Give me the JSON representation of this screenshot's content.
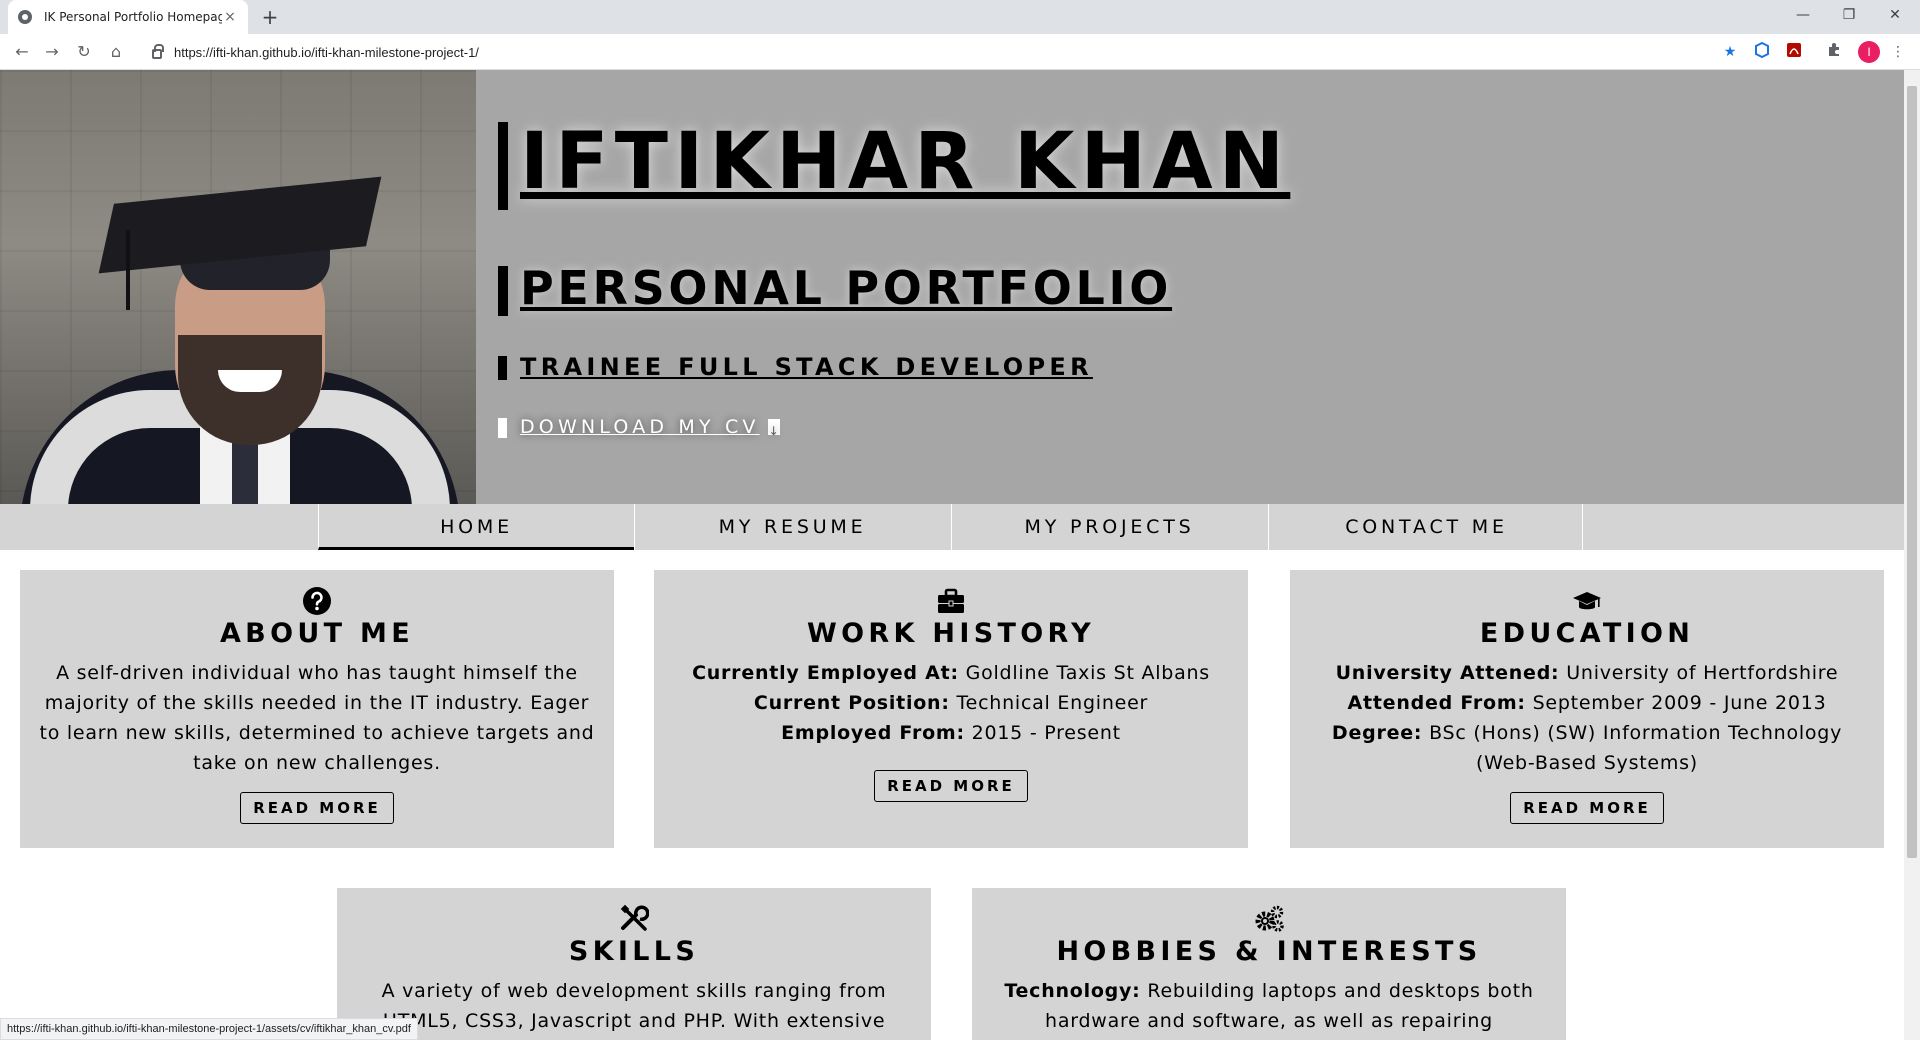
{
  "browser": {
    "tab_title": "IK Personal Portfolio Homepage",
    "tab_close": "×",
    "new_tab": "+",
    "url": "https://ifti-khan.github.io/ifti-khan-milestone-project-1/",
    "status_url": "https://ifti-khan.github.io/ifti-khan-milestone-project-1/assets/cv/iftikhar_khan_cv.pdf",
    "back_glyph": "←",
    "forward_glyph": "→",
    "reload_glyph": "↻",
    "home_glyph": "⌂",
    "minimize_glyph": "—",
    "restore_glyph": "❐",
    "close_glyph": "✕",
    "star_glyph": "★",
    "menu_glyph": "⋮",
    "profile_initial": "I",
    "accent": "#1a73e8"
  },
  "hero": {
    "name": "IFTIKHAR KHAN",
    "subtitle": "PERSONAL PORTFOLIO",
    "role": "TRAINEE FULL STACK DEVELOPER",
    "cv_label": "DOWNLOAD MY CV",
    "background": "#a6a6a6"
  },
  "nav": {
    "items": [
      {
        "label": "HOME",
        "active": true
      },
      {
        "label": "MY RESUME",
        "active": false
      },
      {
        "label": "MY PROJECTS",
        "active": false
      },
      {
        "label": "CONTACT ME",
        "active": false
      }
    ]
  },
  "cards": {
    "about": {
      "icon": "question-circle-icon",
      "title": "ABOUT ME",
      "text": "A self-driven individual who has taught himself the majority of the skills needed in the IT industry. Eager to learn new skills, determined to achieve targets and take on new challenges.",
      "button": "READ MORE"
    },
    "work": {
      "icon": "briefcase-icon",
      "title": "WORK HISTORY",
      "lines": [
        {
          "label": "Currently Employed At:",
          "value": "Goldline Taxis St Albans"
        },
        {
          "label": "Current Position:",
          "value": "Technical Engineer"
        },
        {
          "label": "Employed From:",
          "value": "2015 - Present"
        }
      ],
      "button": "READ MORE"
    },
    "education": {
      "icon": "graduation-cap-icon",
      "title": "EDUCATION",
      "lines": [
        {
          "label": "University Attened:",
          "value": "University of Hertfordshire"
        },
        {
          "label": "Attended From:",
          "value": "September 2009 - June 2013"
        },
        {
          "label": "Degree:",
          "value": "BSc (Hons) (SW) Information Technology (Web-Based Systems)"
        }
      ],
      "button": "READ MORE"
    },
    "skills": {
      "icon": "tools-icon",
      "title": "SKILLS",
      "text": "A variety of web development skills ranging from HTML5, CSS3, Javascript and PHP. With extensive"
    },
    "hobbies": {
      "icon": "cogs-icon",
      "title": "HOBBIES & INTERESTS",
      "label": "Technology:",
      "text": "Rebuilding laptops and desktops both hardware and software, as well as repairing"
    },
    "card_background": "#d4d4d4"
  }
}
